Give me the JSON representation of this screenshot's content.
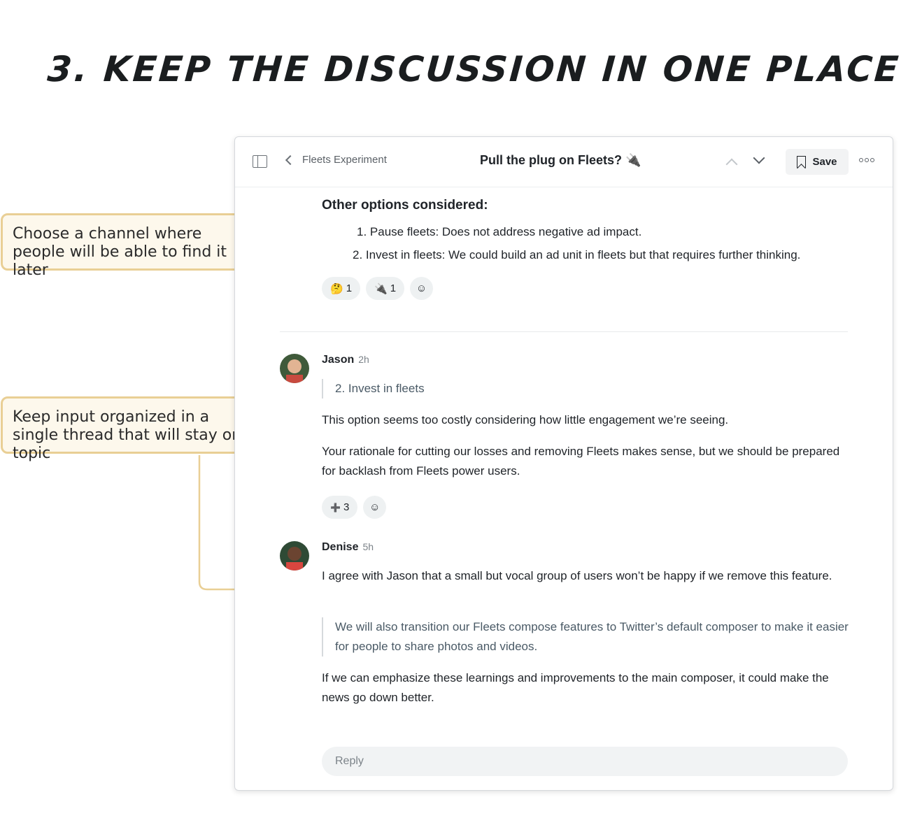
{
  "heading": "3. Keep the discussion in one place",
  "callouts": [
    {
      "text": "Choose a channel where people will be able to find it later"
    },
    {
      "text": "Keep input organized in a single thread that will stay on topic"
    }
  ],
  "window": {
    "header": {
      "back_label": "Fleets Experiment",
      "title": "Pull the plug on Fleets? 🔌",
      "save_label": "Save"
    },
    "first_message": {
      "heading": "Other options considered:",
      "options": [
        "1. Pause fleets: Does not address negative ad impact.",
        "2. Invest in fleets: We could build an ad unit in fleets but that requires further thinking."
      ],
      "reactions": [
        {
          "emoji": "🤔",
          "count": "1"
        },
        {
          "emoji": "🔌",
          "count": "1"
        }
      ]
    },
    "comments": [
      {
        "author": "Jason",
        "time": "2h",
        "quote": "2. Invest in fleets",
        "paragraphs": [
          "This option seems too costly considering how little engagement we’re seeing.",
          "Your rationale for cutting our losses and removing Fleets makes sense, but we should be prepared for backlash from Fleets power users."
        ],
        "reactions": [
          {
            "emoji": "➕",
            "count": "3"
          }
        ]
      },
      {
        "author": "Denise",
        "time": "5h",
        "paragraphs": [
          "I agree with Jason that a small but vocal group of users won’t be happy if we remove this feature.",
          "If we can emphasize these learnings and improvements to the main composer, it could make the news go down better."
        ],
        "quote": "We will also transition our Fleets compose features to Twitter’s default composer to make it easier for people to share photos and videos."
      }
    ],
    "reply": {
      "placeholder": "Reply",
      "value": ""
    }
  }
}
